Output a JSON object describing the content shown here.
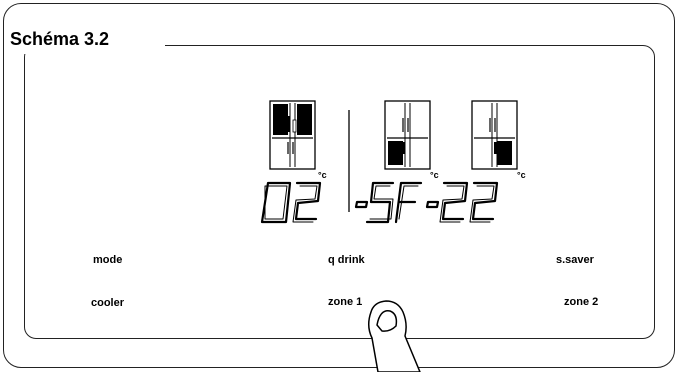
{
  "figure": {
    "title": "Schéma 3.2"
  },
  "display": {
    "zones": [
      {
        "temperature": "02",
        "unit": "°c",
        "lit_section": "top"
      },
      {
        "temperature": "-SF",
        "unit": "°c",
        "lit_section": "bottom-left"
      },
      {
        "temperature": "-22",
        "unit": "°c",
        "lit_section": "bottom-right"
      }
    ]
  },
  "buttons": {
    "mode": "mode",
    "q_drink": "q drink",
    "s_saver": "s.saver",
    "cooler": "cooler",
    "zone1": "zone 1",
    "zone2": "zone 2"
  },
  "hand": {
    "points_at": "zone 1"
  }
}
